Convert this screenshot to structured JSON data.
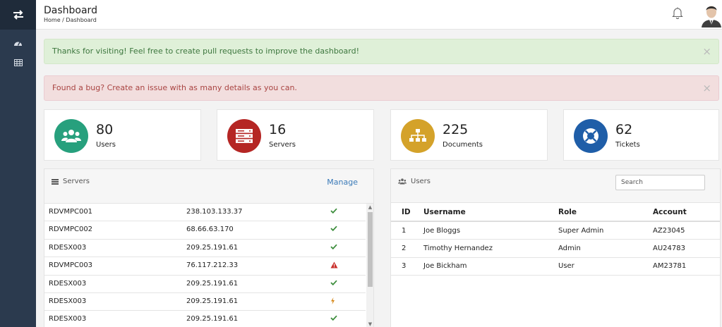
{
  "header": {
    "title": "Dashboard",
    "breadcrumb": "Home / Dashboard"
  },
  "alerts": {
    "success": "Thanks for visiting! Feel free to create pull requests to improve the dashboard!",
    "danger": "Found a bug? Create an issue with as many details as you can.",
    "close": "×"
  },
  "stats": [
    {
      "value": "80",
      "label": "Users",
      "color": "#27a07d",
      "icon": "users-icon"
    },
    {
      "value": "16",
      "label": "Servers",
      "color": "#b52624",
      "icon": "server-icon"
    },
    {
      "value": "225",
      "label": "Documents",
      "color": "#d4a22a",
      "icon": "sitemap-icon"
    },
    {
      "value": "62",
      "label": "Tickets",
      "color": "#1f5ea8",
      "icon": "lifebuoy-icon"
    }
  ],
  "servers": {
    "title": "Servers",
    "manage": "Manage",
    "rows": [
      {
        "name": "RDVMPC001",
        "ip": "238.103.133.37",
        "status": "ok"
      },
      {
        "name": "RDVMPC002",
        "ip": "68.66.63.170",
        "status": "ok"
      },
      {
        "name": "RDESX003",
        "ip": "209.25.191.61",
        "status": "ok"
      },
      {
        "name": "RDVMPC003",
        "ip": "76.117.212.33",
        "status": "warning"
      },
      {
        "name": "RDESX003",
        "ip": "209.25.191.61",
        "status": "ok"
      },
      {
        "name": "RDESX003",
        "ip": "209.25.191.61",
        "status": "power"
      },
      {
        "name": "RDESX003",
        "ip": "209.25.191.61",
        "status": "ok"
      }
    ]
  },
  "users": {
    "title": "Users",
    "search_placeholder": "Search",
    "columns": [
      "ID",
      "Username",
      "Role",
      "Account"
    ],
    "rows": [
      {
        "id": "1",
        "username": "Joe Bloggs",
        "role": "Super Admin",
        "account": "AZ23045"
      },
      {
        "id": "2",
        "username": "Timothy Hernandez",
        "role": "Admin",
        "account": "AU24783"
      },
      {
        "id": "3",
        "username": "Joe Bickham",
        "role": "User",
        "account": "AM23781"
      }
    ]
  },
  "colors": {
    "sidebar": "#2b3a4e",
    "ok": "#3c8d3c",
    "warning": "#c9302c",
    "power": "#d58512",
    "link": "#3a7ab8"
  }
}
